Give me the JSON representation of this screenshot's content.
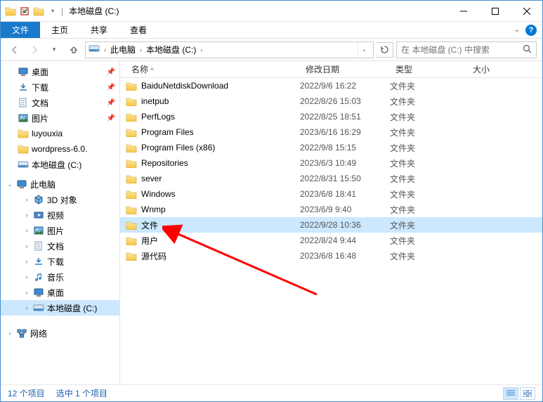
{
  "window": {
    "title": "本地磁盘 (C:)",
    "min": "—",
    "max": "□",
    "close": "✕"
  },
  "menubar": {
    "file": "文件",
    "home": "主页",
    "share": "共享",
    "view": "查看"
  },
  "breadcrumb": {
    "root": "此电脑",
    "drive": "本地磁盘 (C:)"
  },
  "search": {
    "placeholder": "在 本地磁盘 (C:) 中搜索"
  },
  "sidebar": {
    "quick": [
      {
        "label": "桌面",
        "icon": "desktop"
      },
      {
        "label": "下载",
        "icon": "download"
      },
      {
        "label": "文档",
        "icon": "document"
      },
      {
        "label": "图片",
        "icon": "picture"
      },
      {
        "label": "luyouxia",
        "icon": "folder"
      },
      {
        "label": "wordpress-6.0.",
        "icon": "folder"
      },
      {
        "label": "本地磁盘 (C:)",
        "icon": "drive"
      }
    ],
    "thispc_label": "此电脑",
    "thispc_items": [
      {
        "label": "3D 对象",
        "icon": "3d"
      },
      {
        "label": "视频",
        "icon": "video"
      },
      {
        "label": "图片",
        "icon": "picture"
      },
      {
        "label": "文档",
        "icon": "document"
      },
      {
        "label": "下载",
        "icon": "download"
      },
      {
        "label": "音乐",
        "icon": "music"
      },
      {
        "label": "桌面",
        "icon": "desktop"
      },
      {
        "label": "本地磁盘 (C:)",
        "icon": "drive",
        "selected": true
      }
    ],
    "network_label": "网络"
  },
  "columns": {
    "name": "名称",
    "date": "修改日期",
    "type": "类型",
    "size": "大小"
  },
  "rows": [
    {
      "name": "BaiduNetdiskDownload",
      "date": "2022/9/6 16:22",
      "type": "文件夹"
    },
    {
      "name": "inetpub",
      "date": "2022/8/26 15:03",
      "type": "文件夹"
    },
    {
      "name": "PerfLogs",
      "date": "2022/8/25 18:51",
      "type": "文件夹"
    },
    {
      "name": "Program Files",
      "date": "2023/6/16 16:29",
      "type": "文件夹"
    },
    {
      "name": "Program Files (x86)",
      "date": "2022/9/8 15:15",
      "type": "文件夹"
    },
    {
      "name": "Repositories",
      "date": "2023/6/3 10:49",
      "type": "文件夹"
    },
    {
      "name": "sever",
      "date": "2022/8/31 15:50",
      "type": "文件夹"
    },
    {
      "name": "Windows",
      "date": "2023/6/8 18:41",
      "type": "文件夹"
    },
    {
      "name": "Wnmp",
      "date": "2023/6/9 9:40",
      "type": "文件夹"
    },
    {
      "name": "文件",
      "date": "2022/9/28 10:36",
      "type": "文件夹",
      "selected": true
    },
    {
      "name": "用户",
      "date": "2022/8/24 9:44",
      "type": "文件夹"
    },
    {
      "name": "源代码",
      "date": "2023/6/8 16:48",
      "type": "文件夹"
    }
  ],
  "statusbar": {
    "count": "12 个项目",
    "selection": "选中 1 个项目"
  }
}
